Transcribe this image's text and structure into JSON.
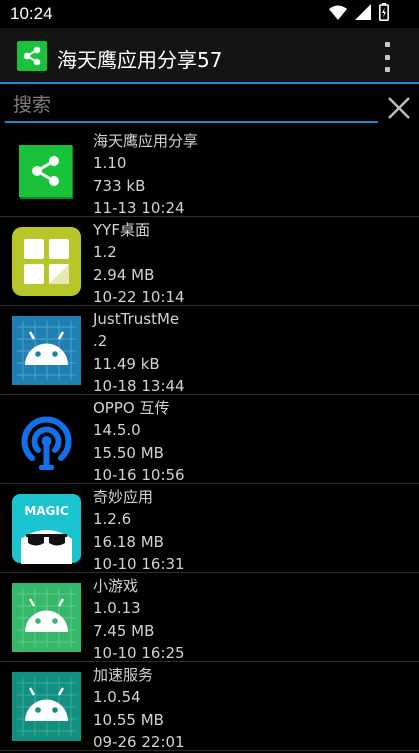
{
  "status_bar": {
    "time": "10:24",
    "icons": [
      "wifi-icon",
      "signal-icon",
      "battery-icon"
    ]
  },
  "app_bar": {
    "title": "海天鹰应用分享57",
    "icon": "share-icon",
    "menu_icon": "overflow-menu-icon"
  },
  "search": {
    "placeholder": "搜索",
    "value": "",
    "clear_icon": "close-icon"
  },
  "apps": [
    {
      "name": "海天鹰应用分享",
      "version": "1.10",
      "size": "733 kB",
      "date": "11-13 10:24",
      "icon": "share-icon"
    },
    {
      "name": "YYF桌面",
      "version": "1.2",
      "size": "2.94 MB",
      "date": "10-22 10:14",
      "icon": "grid-icon"
    },
    {
      "name": "JustTrustMe",
      "version": ".2",
      "size": "11.49 kB",
      "date": "10-18 13:44",
      "icon": "android-icon"
    },
    {
      "name": "OPPO 互传",
      "version": "14.5.0",
      "size": "15.50 MB",
      "date": "10-16 10:56",
      "icon": "broadcast-icon"
    },
    {
      "name": "奇妙应用",
      "version": "1.2.6",
      "size": "16.18 MB",
      "date": "10-10 16:31",
      "icon": "magic-icon",
      "icon_text": "MAGIC"
    },
    {
      "name": "小游戏",
      "version": "1.0.13",
      "size": "7.45 MB",
      "date": "10-10 16:25",
      "icon": "android-icon"
    },
    {
      "name": "加速服务",
      "version": "1.0.54",
      "size": "10.55 MB",
      "date": "09-26 22:01",
      "icon": "android-icon"
    }
  ],
  "colors": {
    "background": "#000000",
    "accent": "#1a8fd0",
    "share_green": "#19c23a",
    "grid_yellow": "#b7c729",
    "android_blue": "#1f7fb0",
    "oppo_blue": "#1270e8",
    "magic_teal": "#1cc4cf",
    "android_green": "#36b86a",
    "android_teal": "#138f80"
  }
}
